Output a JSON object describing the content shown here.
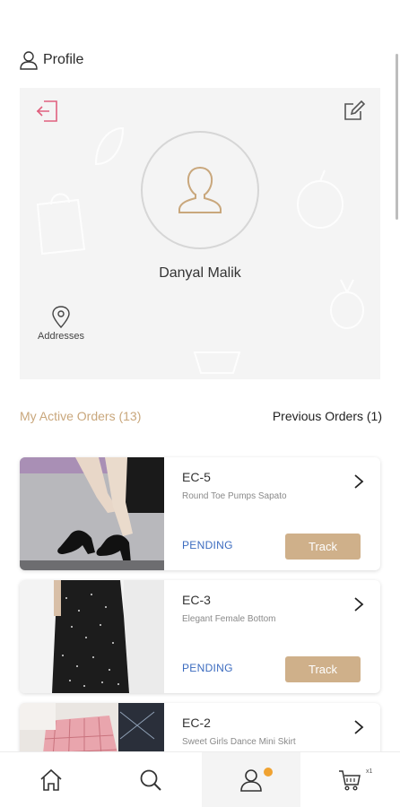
{
  "header": {
    "title": "Profile"
  },
  "profile": {
    "name": "Danyal Malik",
    "addresses_label": "Addresses"
  },
  "orders": {
    "active_tab": "My Active Orders (13)",
    "previous_tab": "Previous Orders (1)",
    "items": [
      {
        "code": "EC-5",
        "description": "Round Toe Pumps Sapato",
        "status": "PENDING",
        "action": "Track"
      },
      {
        "code": "EC-3",
        "description": "Elegant Female Bottom",
        "status": "PENDING",
        "action": "Track"
      },
      {
        "code": "EC-2",
        "description": "Sweet Girls Dance Mini Skirt",
        "status": "",
        "action": ""
      }
    ]
  },
  "bottom_nav": {
    "items": [
      "home-icon",
      "search-icon",
      "profile-icon",
      "cart-icon"
    ],
    "cart_count": "x1"
  },
  "colors": {
    "accent": "#c9a77c",
    "track_button": "#cfb08a",
    "status_pending": "#3b6bbf",
    "logout_icon": "#e0607e",
    "badge": "#f0a231"
  }
}
